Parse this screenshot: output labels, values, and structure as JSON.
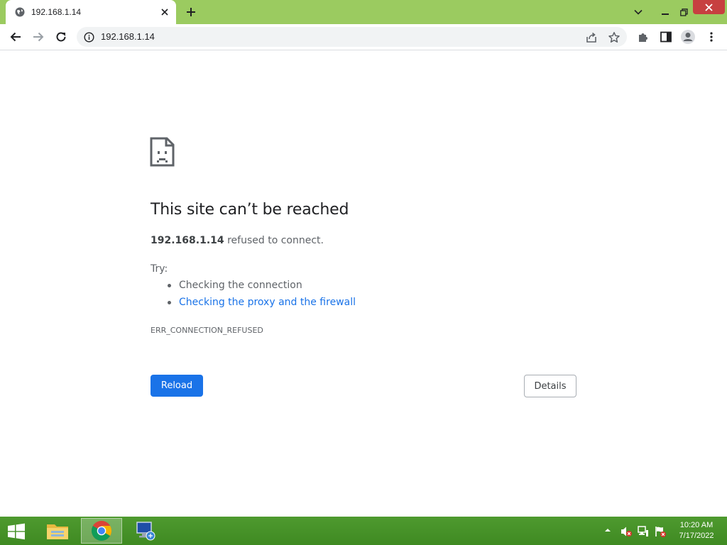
{
  "browser": {
    "tab": {
      "title": "192.168.1.14"
    },
    "address_bar": {
      "url": "192.168.1.14"
    }
  },
  "error_page": {
    "title": "This site can’t be reached",
    "host": "192.168.1.14",
    "message": " refused to connect.",
    "try_label": "Try:",
    "suggestions": [
      "Checking the connection",
      "Checking the proxy and the firewall"
    ],
    "error_code": "ERR_CONNECTION_REFUSED",
    "reload_label": "Reload",
    "details_label": "Details"
  },
  "taskbar": {
    "clock": {
      "time": "10:20 AM",
      "date": "7/17/2022"
    },
    "apps": [
      "file-explorer-icon",
      "chrome-icon",
      "network-computer-icon"
    ]
  },
  "colors": {
    "accent": "#1a73e8",
    "titlebar": "#9bcb60",
    "taskbar": "#4e9a2f",
    "close": "#c74040"
  }
}
